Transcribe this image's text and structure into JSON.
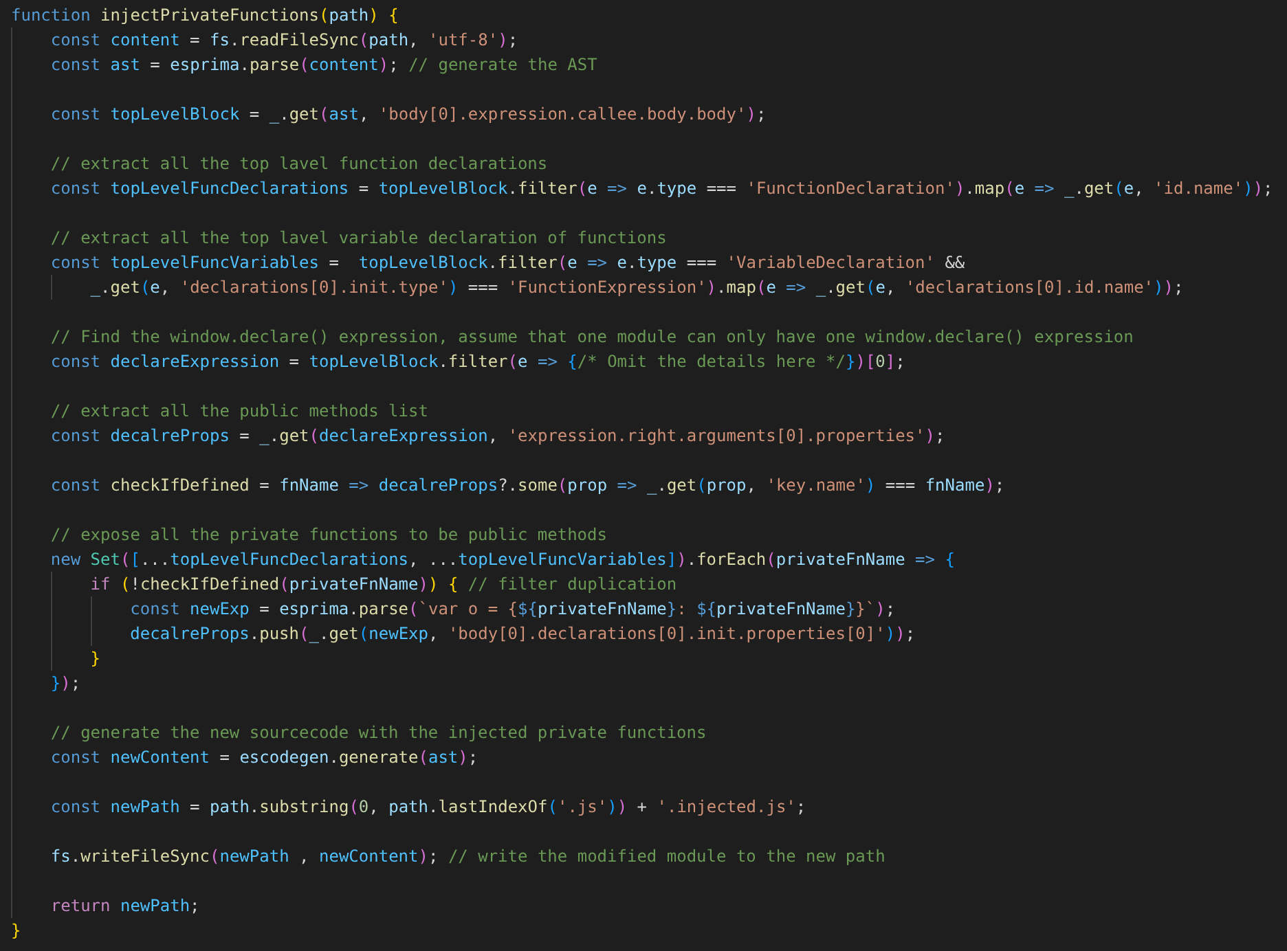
{
  "editor": {
    "lines": [
      {
        "kind": "code",
        "tokens": [
          {
            "kind": "keyword",
            "text": "function "
          },
          {
            "kind": "func",
            "text": "injectPrivateFunctions"
          },
          {
            "kind": "br1",
            "text": "("
          },
          {
            "kind": "var",
            "text": "path"
          },
          {
            "kind": "br1",
            "text": ")"
          },
          {
            "kind": "br1",
            "text": " {"
          }
        ],
        "children": [
          {
            "kind": "code",
            "tokens": [
              {
                "kind": "keyword",
                "text": "const "
              },
              {
                "kind": "const",
                "text": "content"
              },
              {
                "kind": "punct",
                "text": " = "
              },
              {
                "kind": "var",
                "text": "fs"
              },
              {
                "kind": "punct",
                "text": "."
              },
              {
                "kind": "func",
                "text": "readFileSync"
              },
              {
                "kind": "br2",
                "text": "("
              },
              {
                "kind": "var",
                "text": "path"
              },
              {
                "kind": "punct",
                "text": ", "
              },
              {
                "kind": "str",
                "text": "'utf-8'"
              },
              {
                "kind": "br2",
                "text": ")"
              },
              {
                "kind": "punct",
                "text": ";"
              }
            ]
          },
          {
            "kind": "code",
            "tokens": [
              {
                "kind": "keyword",
                "text": "const "
              },
              {
                "kind": "const",
                "text": "ast"
              },
              {
                "kind": "punct",
                "text": " = "
              },
              {
                "kind": "var",
                "text": "esprima"
              },
              {
                "kind": "punct",
                "text": "."
              },
              {
                "kind": "func",
                "text": "parse"
              },
              {
                "kind": "br2",
                "text": "("
              },
              {
                "kind": "const",
                "text": "content"
              },
              {
                "kind": "br2",
                "text": ")"
              },
              {
                "kind": "punct",
                "text": "; "
              },
              {
                "kind": "comment",
                "text": "// generate the AST"
              }
            ]
          },
          {
            "kind": "blank"
          },
          {
            "kind": "code",
            "tokens": [
              {
                "kind": "keyword",
                "text": "const "
              },
              {
                "kind": "const",
                "text": "topLevelBlock"
              },
              {
                "kind": "punct",
                "text": " = "
              },
              {
                "kind": "var",
                "text": "_"
              },
              {
                "kind": "punct",
                "text": "."
              },
              {
                "kind": "func",
                "text": "get"
              },
              {
                "kind": "br2",
                "text": "("
              },
              {
                "kind": "const",
                "text": "ast"
              },
              {
                "kind": "punct",
                "text": ", "
              },
              {
                "kind": "str",
                "text": "'body[0].expression.callee.body.body'"
              },
              {
                "kind": "br2",
                "text": ")"
              },
              {
                "kind": "punct",
                "text": ";"
              }
            ]
          },
          {
            "kind": "blank"
          },
          {
            "kind": "code",
            "tokens": [
              {
                "kind": "comment",
                "text": "// extract all the top lavel function declarations"
              }
            ]
          },
          {
            "kind": "code",
            "tokens": [
              {
                "kind": "keyword",
                "text": "const "
              },
              {
                "kind": "const",
                "text": "topLevelFuncDeclarations"
              },
              {
                "kind": "punct",
                "text": " = "
              },
              {
                "kind": "const",
                "text": "topLevelBlock"
              },
              {
                "kind": "punct",
                "text": "."
              },
              {
                "kind": "func",
                "text": "filter"
              },
              {
                "kind": "br2",
                "text": "("
              },
              {
                "kind": "var",
                "text": "e"
              },
              {
                "kind": "arrow",
                "text": " => "
              },
              {
                "kind": "var",
                "text": "e"
              },
              {
                "kind": "punct",
                "text": "."
              },
              {
                "kind": "var",
                "text": "type"
              },
              {
                "kind": "punct",
                "text": " === "
              },
              {
                "kind": "str",
                "text": "'FunctionDeclaration'"
              },
              {
                "kind": "br2",
                "text": ")"
              },
              {
                "kind": "punct",
                "text": "."
              },
              {
                "kind": "func",
                "text": "map"
              },
              {
                "kind": "br2",
                "text": "("
              },
              {
                "kind": "var",
                "text": "e"
              },
              {
                "kind": "arrow",
                "text": " => "
              },
              {
                "kind": "var",
                "text": "_"
              },
              {
                "kind": "punct",
                "text": "."
              },
              {
                "kind": "func",
                "text": "get"
              },
              {
                "kind": "br3",
                "text": "("
              },
              {
                "kind": "var",
                "text": "e"
              },
              {
                "kind": "punct",
                "text": ", "
              },
              {
                "kind": "str",
                "text": "'id.name'"
              },
              {
                "kind": "br3",
                "text": ")"
              },
              {
                "kind": "br2",
                "text": ")"
              },
              {
                "kind": "punct",
                "text": ";"
              }
            ]
          },
          {
            "kind": "blank"
          },
          {
            "kind": "code",
            "tokens": [
              {
                "kind": "comment",
                "text": "// extract all the top lavel variable declaration of functions"
              }
            ]
          },
          {
            "kind": "code",
            "tokens": [
              {
                "kind": "keyword",
                "text": "const "
              },
              {
                "kind": "const",
                "text": "topLevelFuncVariables"
              },
              {
                "kind": "punct",
                "text": " =  "
              },
              {
                "kind": "const",
                "text": "topLevelBlock"
              },
              {
                "kind": "punct",
                "text": "."
              },
              {
                "kind": "func",
                "text": "filter"
              },
              {
                "kind": "br2",
                "text": "("
              },
              {
                "kind": "var",
                "text": "e"
              },
              {
                "kind": "arrow",
                "text": " => "
              },
              {
                "kind": "var",
                "text": "e"
              },
              {
                "kind": "punct",
                "text": "."
              },
              {
                "kind": "var",
                "text": "type"
              },
              {
                "kind": "punct",
                "text": " === "
              },
              {
                "kind": "str",
                "text": "'VariableDeclaration'"
              },
              {
                "kind": "punct",
                "text": " &&"
              }
            ],
            "children": [
              {
                "kind": "code",
                "tokens": [
                  {
                    "kind": "var",
                    "text": "_"
                  },
                  {
                    "kind": "punct",
                    "text": "."
                  },
                  {
                    "kind": "func",
                    "text": "get"
                  },
                  {
                    "kind": "br3",
                    "text": "("
                  },
                  {
                    "kind": "var",
                    "text": "e"
                  },
                  {
                    "kind": "punct",
                    "text": ", "
                  },
                  {
                    "kind": "str",
                    "text": "'declarations[0].init.type'"
                  },
                  {
                    "kind": "br3",
                    "text": ")"
                  },
                  {
                    "kind": "punct",
                    "text": " === "
                  },
                  {
                    "kind": "str",
                    "text": "'FunctionExpression'"
                  },
                  {
                    "kind": "br2",
                    "text": ")"
                  },
                  {
                    "kind": "punct",
                    "text": "."
                  },
                  {
                    "kind": "func",
                    "text": "map"
                  },
                  {
                    "kind": "br2",
                    "text": "("
                  },
                  {
                    "kind": "var",
                    "text": "e"
                  },
                  {
                    "kind": "arrow",
                    "text": " => "
                  },
                  {
                    "kind": "var",
                    "text": "_"
                  },
                  {
                    "kind": "punct",
                    "text": "."
                  },
                  {
                    "kind": "func",
                    "text": "get"
                  },
                  {
                    "kind": "br3",
                    "text": "("
                  },
                  {
                    "kind": "var",
                    "text": "e"
                  },
                  {
                    "kind": "punct",
                    "text": ", "
                  },
                  {
                    "kind": "str",
                    "text": "'declarations[0].id.name'"
                  },
                  {
                    "kind": "br3",
                    "text": ")"
                  },
                  {
                    "kind": "br2",
                    "text": ")"
                  },
                  {
                    "kind": "punct",
                    "text": ";"
                  }
                ]
              }
            ]
          },
          {
            "kind": "blank"
          },
          {
            "kind": "code",
            "tokens": [
              {
                "kind": "comment",
                "text": "// Find the window.declare() expression, assume that one module can only have one window.declare() expression"
              }
            ]
          },
          {
            "kind": "code",
            "tokens": [
              {
                "kind": "keyword",
                "text": "const "
              },
              {
                "kind": "const",
                "text": "declareExpression"
              },
              {
                "kind": "punct",
                "text": " = "
              },
              {
                "kind": "const",
                "text": "topLevelBlock"
              },
              {
                "kind": "punct",
                "text": "."
              },
              {
                "kind": "func",
                "text": "filter"
              },
              {
                "kind": "br2",
                "text": "("
              },
              {
                "kind": "var",
                "text": "e"
              },
              {
                "kind": "arrow",
                "text": " => "
              },
              {
                "kind": "br3",
                "text": "{"
              },
              {
                "kind": "comment",
                "text": "/* Omit the details here */"
              },
              {
                "kind": "br3",
                "text": "}"
              },
              {
                "kind": "br2",
                "text": ")"
              },
              {
                "kind": "br2",
                "text": "["
              },
              {
                "kind": "num",
                "text": "0"
              },
              {
                "kind": "br2",
                "text": "]"
              },
              {
                "kind": "punct",
                "text": ";"
              }
            ]
          },
          {
            "kind": "blank"
          },
          {
            "kind": "code",
            "tokens": [
              {
                "kind": "comment",
                "text": "// extract all the public methods list"
              }
            ]
          },
          {
            "kind": "code",
            "tokens": [
              {
                "kind": "keyword",
                "text": "const "
              },
              {
                "kind": "const",
                "text": "decalreProps"
              },
              {
                "kind": "punct",
                "text": " = "
              },
              {
                "kind": "var",
                "text": "_"
              },
              {
                "kind": "punct",
                "text": "."
              },
              {
                "kind": "func",
                "text": "get"
              },
              {
                "kind": "br2",
                "text": "("
              },
              {
                "kind": "const",
                "text": "declareExpression"
              },
              {
                "kind": "punct",
                "text": ", "
              },
              {
                "kind": "str",
                "text": "'expression.right.arguments[0].properties'"
              },
              {
                "kind": "br2",
                "text": ")"
              },
              {
                "kind": "punct",
                "text": ";"
              }
            ]
          },
          {
            "kind": "blank"
          },
          {
            "kind": "code",
            "tokens": [
              {
                "kind": "keyword",
                "text": "const "
              },
              {
                "kind": "func",
                "text": "checkIfDefined"
              },
              {
                "kind": "punct",
                "text": " = "
              },
              {
                "kind": "var",
                "text": "fnName"
              },
              {
                "kind": "arrow",
                "text": " => "
              },
              {
                "kind": "const",
                "text": "decalreProps"
              },
              {
                "kind": "punct",
                "text": "?."
              },
              {
                "kind": "func",
                "text": "some"
              },
              {
                "kind": "br2",
                "text": "("
              },
              {
                "kind": "var",
                "text": "prop"
              },
              {
                "kind": "arrow",
                "text": " => "
              },
              {
                "kind": "var",
                "text": "_"
              },
              {
                "kind": "punct",
                "text": "."
              },
              {
                "kind": "func",
                "text": "get"
              },
              {
                "kind": "br3",
                "text": "("
              },
              {
                "kind": "var",
                "text": "prop"
              },
              {
                "kind": "punct",
                "text": ", "
              },
              {
                "kind": "str",
                "text": "'key.name'"
              },
              {
                "kind": "br3",
                "text": ")"
              },
              {
                "kind": "punct",
                "text": " === "
              },
              {
                "kind": "var",
                "text": "fnName"
              },
              {
                "kind": "br2",
                "text": ")"
              },
              {
                "kind": "punct",
                "text": ";"
              }
            ]
          },
          {
            "kind": "blank"
          },
          {
            "kind": "code",
            "tokens": [
              {
                "kind": "comment",
                "text": "// expose all the private functions to be public methods"
              }
            ]
          },
          {
            "kind": "code",
            "tokens": [
              {
                "kind": "keyword",
                "text": "new "
              },
              {
                "kind": "type",
                "text": "Set"
              },
              {
                "kind": "br2",
                "text": "("
              },
              {
                "kind": "br3",
                "text": "["
              },
              {
                "kind": "punct",
                "text": "..."
              },
              {
                "kind": "const",
                "text": "topLevelFuncDeclarations"
              },
              {
                "kind": "punct",
                "text": ", ..."
              },
              {
                "kind": "const",
                "text": "topLevelFuncVariables"
              },
              {
                "kind": "br3",
                "text": "]"
              },
              {
                "kind": "br2",
                "text": ")"
              },
              {
                "kind": "punct",
                "text": "."
              },
              {
                "kind": "func",
                "text": "forEach"
              },
              {
                "kind": "br2",
                "text": "("
              },
              {
                "kind": "var",
                "text": "privateFnName"
              },
              {
                "kind": "arrow",
                "text": " => "
              },
              {
                "kind": "br3",
                "text": "{"
              }
            ],
            "children": [
              {
                "kind": "code",
                "tokens": [
                  {
                    "kind": "control",
                    "text": "if "
                  },
                  {
                    "kind": "br1",
                    "text": "("
                  },
                  {
                    "kind": "punct",
                    "text": "!"
                  },
                  {
                    "kind": "func",
                    "text": "checkIfDefined"
                  },
                  {
                    "kind": "br2",
                    "text": "("
                  },
                  {
                    "kind": "var",
                    "text": "privateFnName"
                  },
                  {
                    "kind": "br2",
                    "text": ")"
                  },
                  {
                    "kind": "br1",
                    "text": ")"
                  },
                  {
                    "kind": "br1",
                    "text": " {"
                  },
                  {
                    "kind": "comment",
                    "text": " // filter duplication"
                  }
                ],
                "children": [
                  {
                    "kind": "code",
                    "tokens": [
                      {
                        "kind": "keyword",
                        "text": "const "
                      },
                      {
                        "kind": "const",
                        "text": "newExp"
                      },
                      {
                        "kind": "punct",
                        "text": " = "
                      },
                      {
                        "kind": "var",
                        "text": "esprima"
                      },
                      {
                        "kind": "punct",
                        "text": "."
                      },
                      {
                        "kind": "func",
                        "text": "parse"
                      },
                      {
                        "kind": "br2",
                        "text": "("
                      },
                      {
                        "kind": "str",
                        "text": "`var o = {"
                      },
                      {
                        "kind": "arrow",
                        "text": "${"
                      },
                      {
                        "kind": "var",
                        "text": "privateFnName"
                      },
                      {
                        "kind": "arrow",
                        "text": "}"
                      },
                      {
                        "kind": "str",
                        "text": ": "
                      },
                      {
                        "kind": "arrow",
                        "text": "${"
                      },
                      {
                        "kind": "var",
                        "text": "privateFnName"
                      },
                      {
                        "kind": "arrow",
                        "text": "}"
                      },
                      {
                        "kind": "str",
                        "text": "}`"
                      },
                      {
                        "kind": "br2",
                        "text": ")"
                      },
                      {
                        "kind": "punct",
                        "text": ";"
                      }
                    ]
                  },
                  {
                    "kind": "code",
                    "tokens": [
                      {
                        "kind": "const",
                        "text": "decalreProps"
                      },
                      {
                        "kind": "punct",
                        "text": "."
                      },
                      {
                        "kind": "func",
                        "text": "push"
                      },
                      {
                        "kind": "br2",
                        "text": "("
                      },
                      {
                        "kind": "var",
                        "text": "_"
                      },
                      {
                        "kind": "punct",
                        "text": "."
                      },
                      {
                        "kind": "func",
                        "text": "get"
                      },
                      {
                        "kind": "br3",
                        "text": "("
                      },
                      {
                        "kind": "const",
                        "text": "newExp"
                      },
                      {
                        "kind": "punct",
                        "text": ", "
                      },
                      {
                        "kind": "str",
                        "text": "'body[0].declarations[0].init.properties[0]'"
                      },
                      {
                        "kind": "br3",
                        "text": ")"
                      },
                      {
                        "kind": "br2",
                        "text": ")"
                      },
                      {
                        "kind": "punct",
                        "text": ";"
                      }
                    ]
                  }
                ]
              },
              {
                "kind": "code",
                "tokens": [
                  {
                    "kind": "br1",
                    "text": "}"
                  }
                ]
              }
            ]
          },
          {
            "kind": "code",
            "tokens": [
              {
                "kind": "br3",
                "text": "}"
              },
              {
                "kind": "br2",
                "text": ")"
              },
              {
                "kind": "punct",
                "text": ";"
              }
            ]
          },
          {
            "kind": "blank"
          },
          {
            "kind": "code",
            "tokens": [
              {
                "kind": "comment",
                "text": "// generate the new sourcecode with the injected private functions"
              }
            ]
          },
          {
            "kind": "code",
            "tokens": [
              {
                "kind": "keyword",
                "text": "const "
              },
              {
                "kind": "const",
                "text": "newContent"
              },
              {
                "kind": "punct",
                "text": " = "
              },
              {
                "kind": "var",
                "text": "escodegen"
              },
              {
                "kind": "punct",
                "text": "."
              },
              {
                "kind": "func",
                "text": "generate"
              },
              {
                "kind": "br2",
                "text": "("
              },
              {
                "kind": "const",
                "text": "ast"
              },
              {
                "kind": "br2",
                "text": ")"
              },
              {
                "kind": "punct",
                "text": ";"
              }
            ]
          },
          {
            "kind": "blank"
          },
          {
            "kind": "code",
            "tokens": [
              {
                "kind": "keyword",
                "text": "const "
              },
              {
                "kind": "const",
                "text": "newPath"
              },
              {
                "kind": "punct",
                "text": " = "
              },
              {
                "kind": "var",
                "text": "path"
              },
              {
                "kind": "punct",
                "text": "."
              },
              {
                "kind": "func",
                "text": "substring"
              },
              {
                "kind": "br2",
                "text": "("
              },
              {
                "kind": "num",
                "text": "0"
              },
              {
                "kind": "punct",
                "text": ", "
              },
              {
                "kind": "var",
                "text": "path"
              },
              {
                "kind": "punct",
                "text": "."
              },
              {
                "kind": "func",
                "text": "lastIndexOf"
              },
              {
                "kind": "br3",
                "text": "("
              },
              {
                "kind": "str",
                "text": "'.js'"
              },
              {
                "kind": "br3",
                "text": ")"
              },
              {
                "kind": "br2",
                "text": ")"
              },
              {
                "kind": "punct",
                "text": " + "
              },
              {
                "kind": "str",
                "text": "'.injected.js'"
              },
              {
                "kind": "punct",
                "text": ";"
              }
            ]
          },
          {
            "kind": "blank"
          },
          {
            "kind": "code",
            "tokens": [
              {
                "kind": "var",
                "text": "fs"
              },
              {
                "kind": "punct",
                "text": "."
              },
              {
                "kind": "func",
                "text": "writeFileSync"
              },
              {
                "kind": "br2",
                "text": "("
              },
              {
                "kind": "const",
                "text": "newPath"
              },
              {
                "kind": "punct",
                "text": " , "
              },
              {
                "kind": "const",
                "text": "newContent"
              },
              {
                "kind": "br2",
                "text": ")"
              },
              {
                "kind": "punct",
                "text": "; "
              },
              {
                "kind": "comment",
                "text": "// write the modified module to the new path"
              }
            ]
          },
          {
            "kind": "blank"
          },
          {
            "kind": "code",
            "tokens": [
              {
                "kind": "control",
                "text": "return "
              },
              {
                "kind": "const",
                "text": "newPath"
              },
              {
                "kind": "punct",
                "text": ";"
              }
            ]
          }
        ]
      },
      {
        "kind": "code",
        "tokens": [
          {
            "kind": "br1",
            "text": "}"
          }
        ]
      }
    ]
  }
}
